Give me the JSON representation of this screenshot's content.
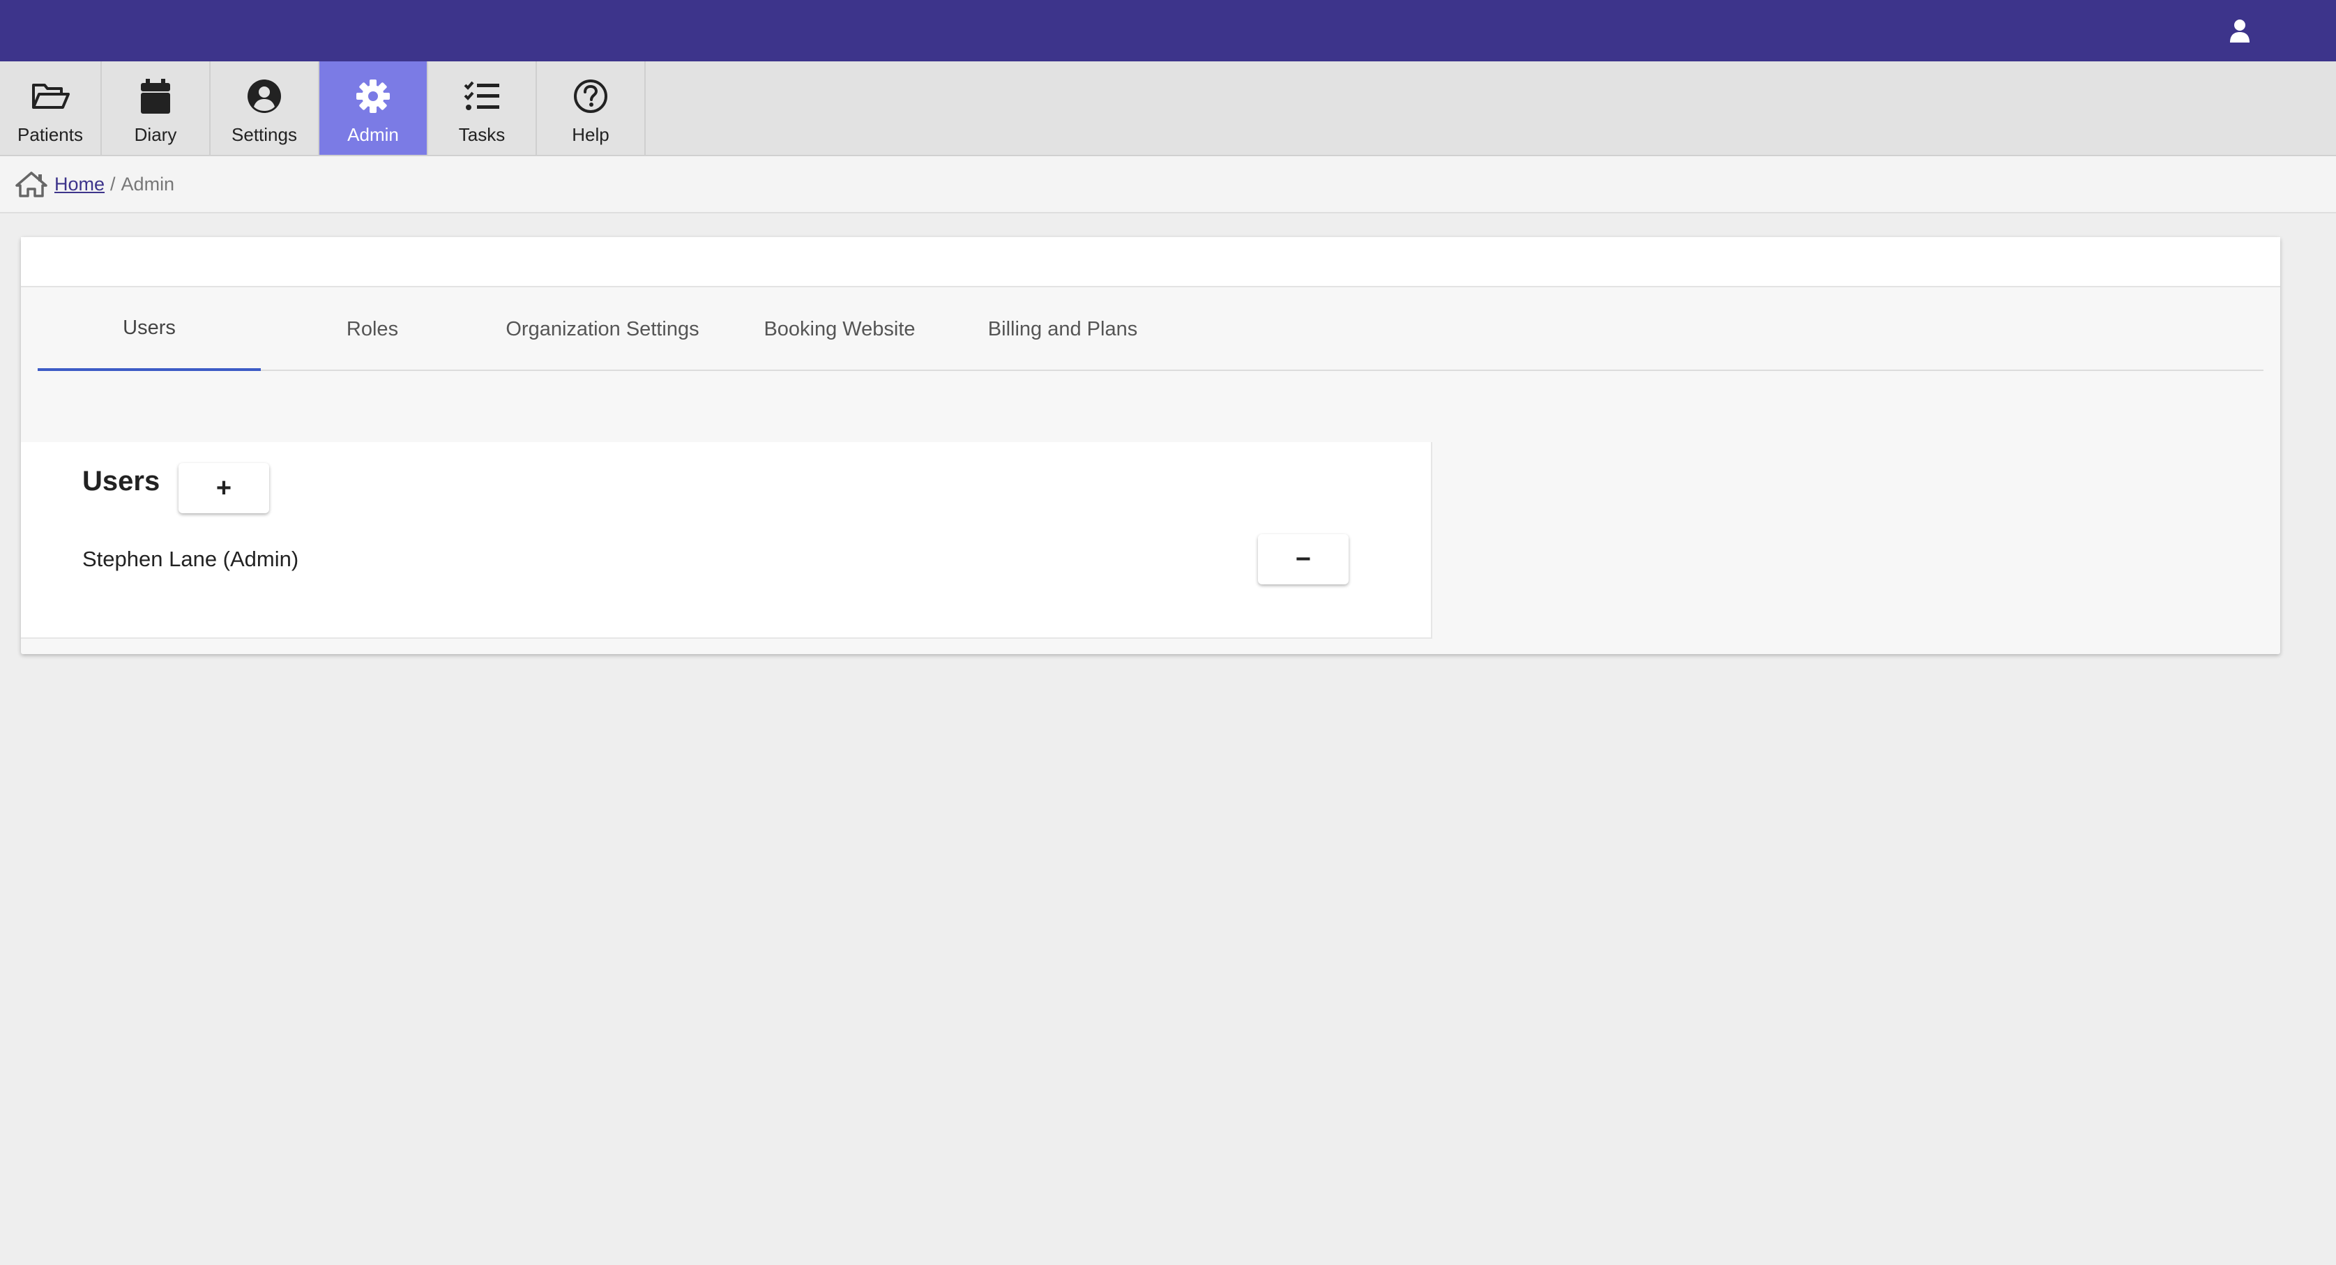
{
  "colors": {
    "topbar": "#3d348b",
    "active_nav": "#7b7be5",
    "tab_underline": "#3d5cc6"
  },
  "topbar": {
    "user_icon": "user-icon"
  },
  "nav": {
    "items": [
      {
        "label": "Patients",
        "icon": "folder-open-icon"
      },
      {
        "label": "Diary",
        "icon": "calendar-icon"
      },
      {
        "label": "Settings",
        "icon": "user-circle-icon"
      },
      {
        "label": "Admin",
        "icon": "gear-icon",
        "active": true
      },
      {
        "label": "Tasks",
        "icon": "tasks-list-icon"
      },
      {
        "label": "Help",
        "icon": "help-circle-icon"
      }
    ]
  },
  "breadcrumb": {
    "home_icon": "home-icon",
    "home": "Home",
    "separator": "/",
    "current": "Admin"
  },
  "tabs": [
    {
      "label": "Users",
      "active": true
    },
    {
      "label": "Roles"
    },
    {
      "label": "Organization Settings"
    },
    {
      "label": "Booking Website"
    },
    {
      "label": "Billing and Plans"
    }
  ],
  "users_section": {
    "title": "Users",
    "add_label": "+",
    "users": [
      {
        "name": "Stephen Lane (Admin)",
        "remove_label": "−"
      }
    ]
  }
}
